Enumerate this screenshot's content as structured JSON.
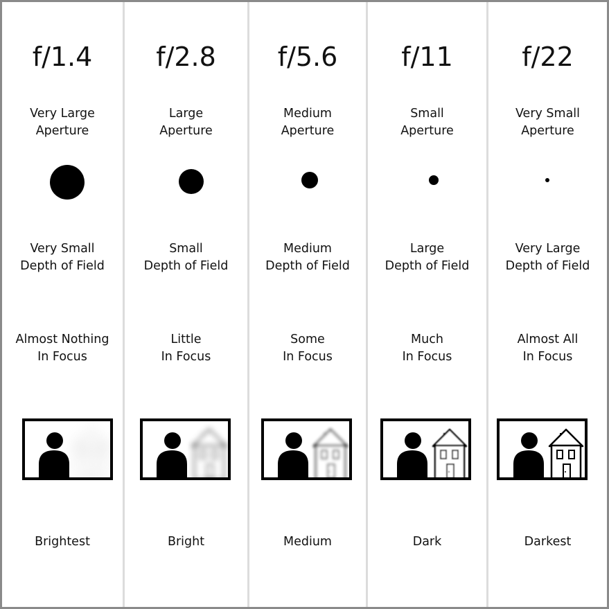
{
  "columns": [
    {
      "f_stop": "f/1.4",
      "aperture": [
        "Very Large",
        "Aperture"
      ],
      "depth_of_field": [
        "Very Small",
        "Depth of Field"
      ],
      "focus": [
        "Almost Nothing",
        "In Focus"
      ],
      "brightness": "Brightest",
      "aperture_diameter_relative": 1.0,
      "background_blur": 9
    },
    {
      "f_stop": "f/2.8",
      "aperture": [
        "Large",
        "Aperture"
      ],
      "depth_of_field": [
        "Small",
        "Depth of Field"
      ],
      "focus": [
        "Little",
        "In Focus"
      ],
      "brightness": "Bright",
      "aperture_diameter_relative": 0.72,
      "background_blur": 4
    },
    {
      "f_stop": "f/5.6",
      "aperture": [
        "Medium",
        "Aperture"
      ],
      "depth_of_field": [
        "Medium",
        "Depth of Field"
      ],
      "focus": [
        "Some",
        "In Focus"
      ],
      "brightness": "Medium",
      "aperture_diameter_relative": 0.48,
      "background_blur": 2
    },
    {
      "f_stop": "f/11",
      "aperture": [
        "Small",
        "Aperture"
      ],
      "depth_of_field": [
        "Large",
        "Depth of Field"
      ],
      "focus": [
        "Much",
        "In Focus"
      ],
      "brightness": "Dark",
      "aperture_diameter_relative": 0.28,
      "background_blur": 0.8
    },
    {
      "f_stop": "f/22",
      "aperture": [
        "Very Small",
        "Aperture"
      ],
      "depth_of_field": [
        "Very Large",
        "Depth of Field"
      ],
      "focus": [
        "Almost All",
        "In Focus"
      ],
      "brightness": "Darkest",
      "aperture_diameter_relative": 0.12,
      "background_blur": 0
    }
  ],
  "colors": {
    "ink": "#000000",
    "border": "#8a8a8a",
    "separator": "#dcdcdc"
  }
}
